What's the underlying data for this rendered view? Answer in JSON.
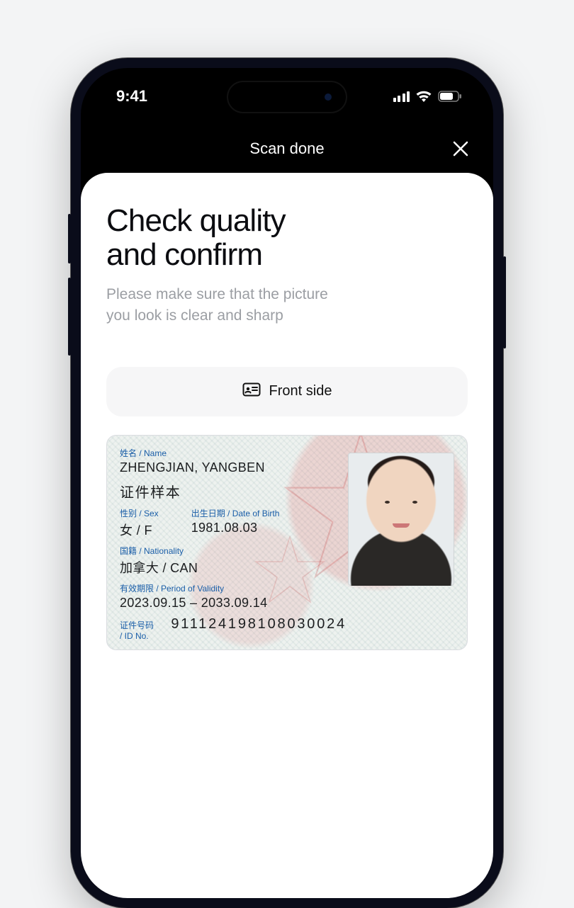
{
  "status_bar": {
    "time": "9:41",
    "cellular_icon": "cellular-signal-icon",
    "wifi_icon": "wifi-icon",
    "battery_icon": "battery-icon"
  },
  "nav": {
    "title": "Scan done",
    "close_icon": "close-icon"
  },
  "sheet": {
    "headline_line1": "Check quality",
    "headline_line2": "and confirm",
    "subtext_line1": "Please make sure that the picture",
    "subtext_line2": "you look is clear and sharp",
    "side_chip": {
      "icon": "id-card-icon",
      "label": "Front side"
    }
  },
  "id_card": {
    "name_label": "姓名 / Name",
    "name_value": "ZHENGJIAN, YANGBEN",
    "name_cjk": "证件样本",
    "sex_label": "性别 / Sex",
    "sex_value": "女 / F",
    "dob_label": "出生日期 / Date of Birth",
    "dob_value": "1981.08.03",
    "nationality_label": "国籍 / Nationality",
    "nationality_value": "加拿大 / CAN",
    "validity_label": "有效期限 / Period of Validity",
    "validity_value": "2023.09.15 – 2033.09.14",
    "idno_label": "证件号码 / ID No.",
    "idno_value": "911124198108030024"
  }
}
